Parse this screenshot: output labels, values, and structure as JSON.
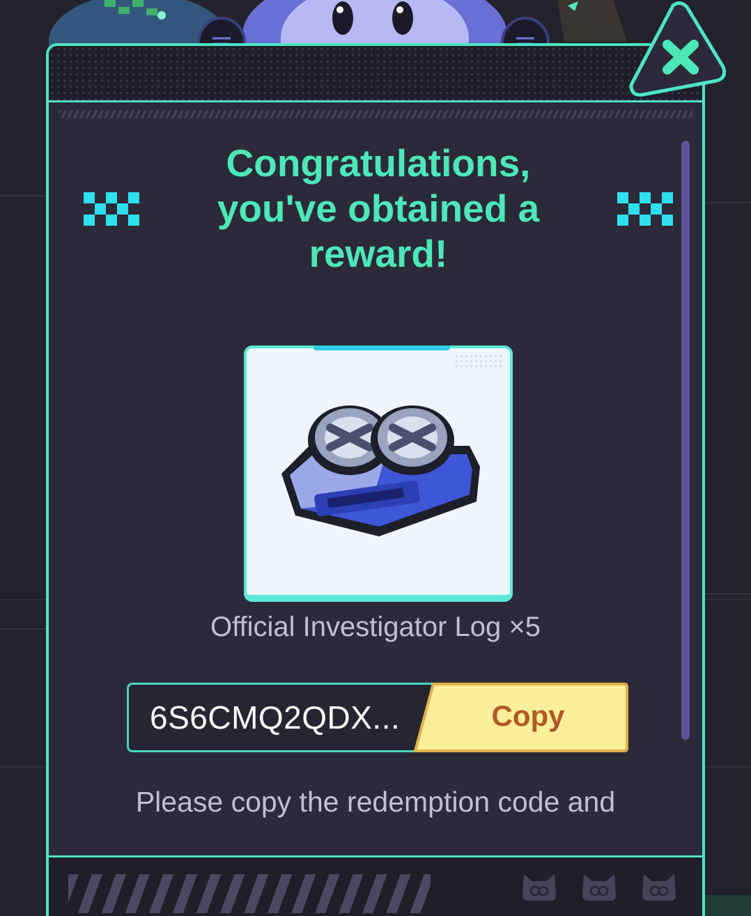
{
  "dialog": {
    "title": "Congratulations, you've obtained a reward!",
    "reward": {
      "name": "Official Investigator Log ×5",
      "icon": "tape-recorder-icon"
    },
    "redemption_code": "6S6CMQ2QDX...",
    "copy_label": "Copy",
    "instructions": "Please copy the redemption code and",
    "close_icon": "close-icon"
  },
  "colors": {
    "accent": "#4de5c4",
    "title": "#4de8b8",
    "copy_button_bg": "#fbef9b",
    "copy_button_text": "#b1582a",
    "scrollbar": "#5e529a"
  }
}
